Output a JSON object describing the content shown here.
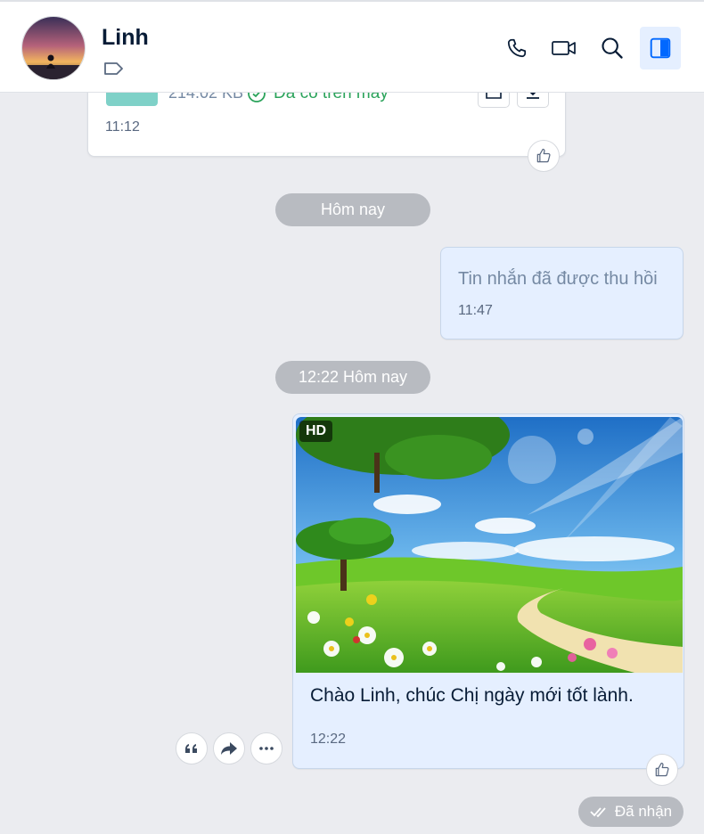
{
  "header": {
    "contact_name": "Linh",
    "icons": [
      "phone-icon",
      "video-call-icon",
      "search-icon",
      "sidebar-toggle-icon"
    ],
    "active_color": "#e5efff"
  },
  "file_message": {
    "size": "214.02 KB",
    "status": "Đã có trên máy",
    "time": "11:12"
  },
  "date_divider_1": "Hôm nay",
  "recalled_message": {
    "text": "Tin nhắn đã được thu hồi",
    "time": "11:47"
  },
  "date_divider_2": "12:22 Hôm nay",
  "image_message": {
    "hd_badge": "HD",
    "caption": "Chào Linh, chúc Chị ngày mới tốt lành.",
    "time": "12:22"
  },
  "message_status": "Đã nhận",
  "colors": {
    "background": "#ebecf0",
    "my_bubble": "#e5efff",
    "accent": "#0068ff",
    "success": "#2ba35b"
  }
}
